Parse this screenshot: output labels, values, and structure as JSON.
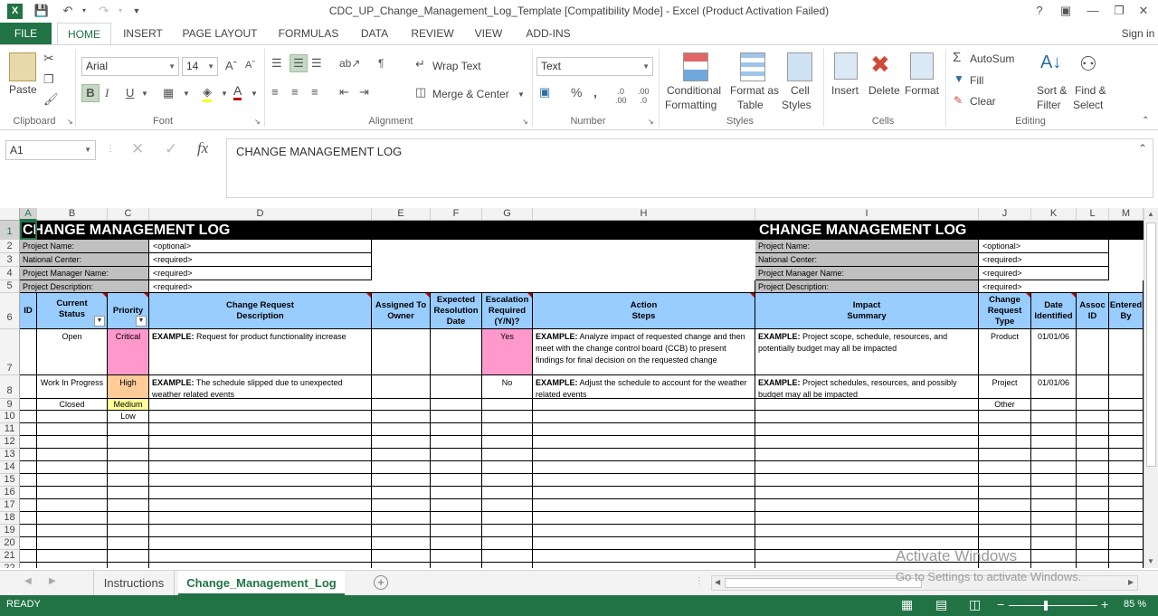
{
  "titlebar": {
    "title": "CDC_UP_Change_Management_Log_Template  [Compatibility Mode] - Excel (Product Activation Failed)",
    "help": "?"
  },
  "ribbon_tabs": [
    "FILE",
    "HOME",
    "INSERT",
    "PAGE LAYOUT",
    "FORMULAS",
    "DATA",
    "REVIEW",
    "VIEW",
    "ADD-INS"
  ],
  "sign_in": "Sign in",
  "ribbon": {
    "paste": "Paste",
    "font_name": "Arial",
    "font_size": "14",
    "bold": "B",
    "italic": "I",
    "underline": "U",
    "wrap_text": "Wrap Text",
    "merge_center": "Merge & Center",
    "number_format": "Text",
    "conditional1": "Conditional",
    "conditional2": "Formatting",
    "format_table1": "Format as",
    "format_table2": "Table",
    "cell_styles1": "Cell",
    "cell_styles2": "Styles",
    "insert": "Insert",
    "delete": "Delete",
    "format": "Format",
    "autosum": "AutoSum",
    "fill": "Fill",
    "clear": "Clear",
    "sort1": "Sort &",
    "sort2": "Filter",
    "find1": "Find &",
    "find2": "Select",
    "groups": {
      "clipboard": "Clipboard",
      "font": "Font",
      "alignment": "Alignment",
      "number": "Number",
      "styles": "Styles",
      "cells": "Cells",
      "editing": "Editing"
    }
  },
  "formula_bar": {
    "name_box": "A1",
    "fx": "fx",
    "content": "CHANGE MANAGEMENT LOG"
  },
  "columns": [
    "A",
    "B",
    "C",
    "D",
    "E",
    "F",
    "G",
    "H",
    "I",
    "J",
    "K",
    "L",
    "M"
  ],
  "rows": [
    "1",
    "2",
    "3",
    "4",
    "5",
    "6",
    "7",
    "8",
    "9",
    "10",
    "11",
    "12",
    "13",
    "14",
    "15",
    "16",
    "17",
    "18",
    "19",
    "20",
    "21",
    "22"
  ],
  "sheet": {
    "title_left": "CHANGE MANAGEMENT LOG",
    "title_right": "CHANGE MANAGEMENT LOG",
    "project_name_label": "Project Name:",
    "national_center_label": "National Center:",
    "pm_name_label": "Project Manager Name:",
    "project_desc_label": "Project Description:",
    "optional": "<optional>",
    "required": "<required>",
    "headers": {
      "id": "ID",
      "status": "Current Status",
      "priority": "Priority",
      "description": "Change Request Description",
      "assigned": "Assigned To Owner",
      "expected": "Expected Resolution Date",
      "escalation": "Escalation Required (Y/N)?",
      "action": "Action Steps",
      "impact": "Impact Summary",
      "type": "Change Request Type",
      "date": "Date Identified",
      "assoc": "Assoc ID",
      "entered": "Entered By"
    },
    "row7": {
      "status": "Open",
      "priority": "Critical",
      "desc_bold": "EXAMPLE:",
      "desc": " Request for product functionality increase",
      "escalation": "Yes",
      "action_bold": "EXAMPLE:",
      "action": " Analyze impact of requested change and then meet with the change control board (CCB) to present findings for final decision on the requested change",
      "impact_bold": "EXAMPLE:",
      "impact": " Project scope, schedule, resources, and potentially budget may all be impacted",
      "type": "Product",
      "date": "01/01/06"
    },
    "row8": {
      "status": "Work In Progress",
      "priority": "High",
      "desc_bold": "EXAMPLE:",
      "desc": " The schedule slipped due to unexpected weather related events",
      "escalation": "No",
      "action_bold": "EXAMPLE:",
      "action": " Adjust the schedule to account for the weather related events",
      "impact_bold": "EXAMPLE:",
      "impact": " Project schedules, resources, and possibly budget may all be impacted",
      "type": "Project",
      "date": "01/01/06"
    },
    "row9": {
      "status": "Closed",
      "priority": "Medium",
      "type": "Other"
    },
    "row10": {
      "priority": "Low"
    }
  },
  "sheet_tabs": [
    "Instructions",
    "Change_Management_Log"
  ],
  "watermark": {
    "line1": "Activate Windows",
    "line2": "Go to Settings to activate Windows."
  },
  "statusbar": {
    "ready": "READY",
    "zoom": "85 %"
  },
  "colors": {
    "excel_green": "#217346",
    "header_blue": "#99ccff",
    "critical_pink": "#ff99cc",
    "high_orange": "#ffcc99",
    "medium_yellow": "#ffff99",
    "label_gray": "#c0c0c0"
  }
}
